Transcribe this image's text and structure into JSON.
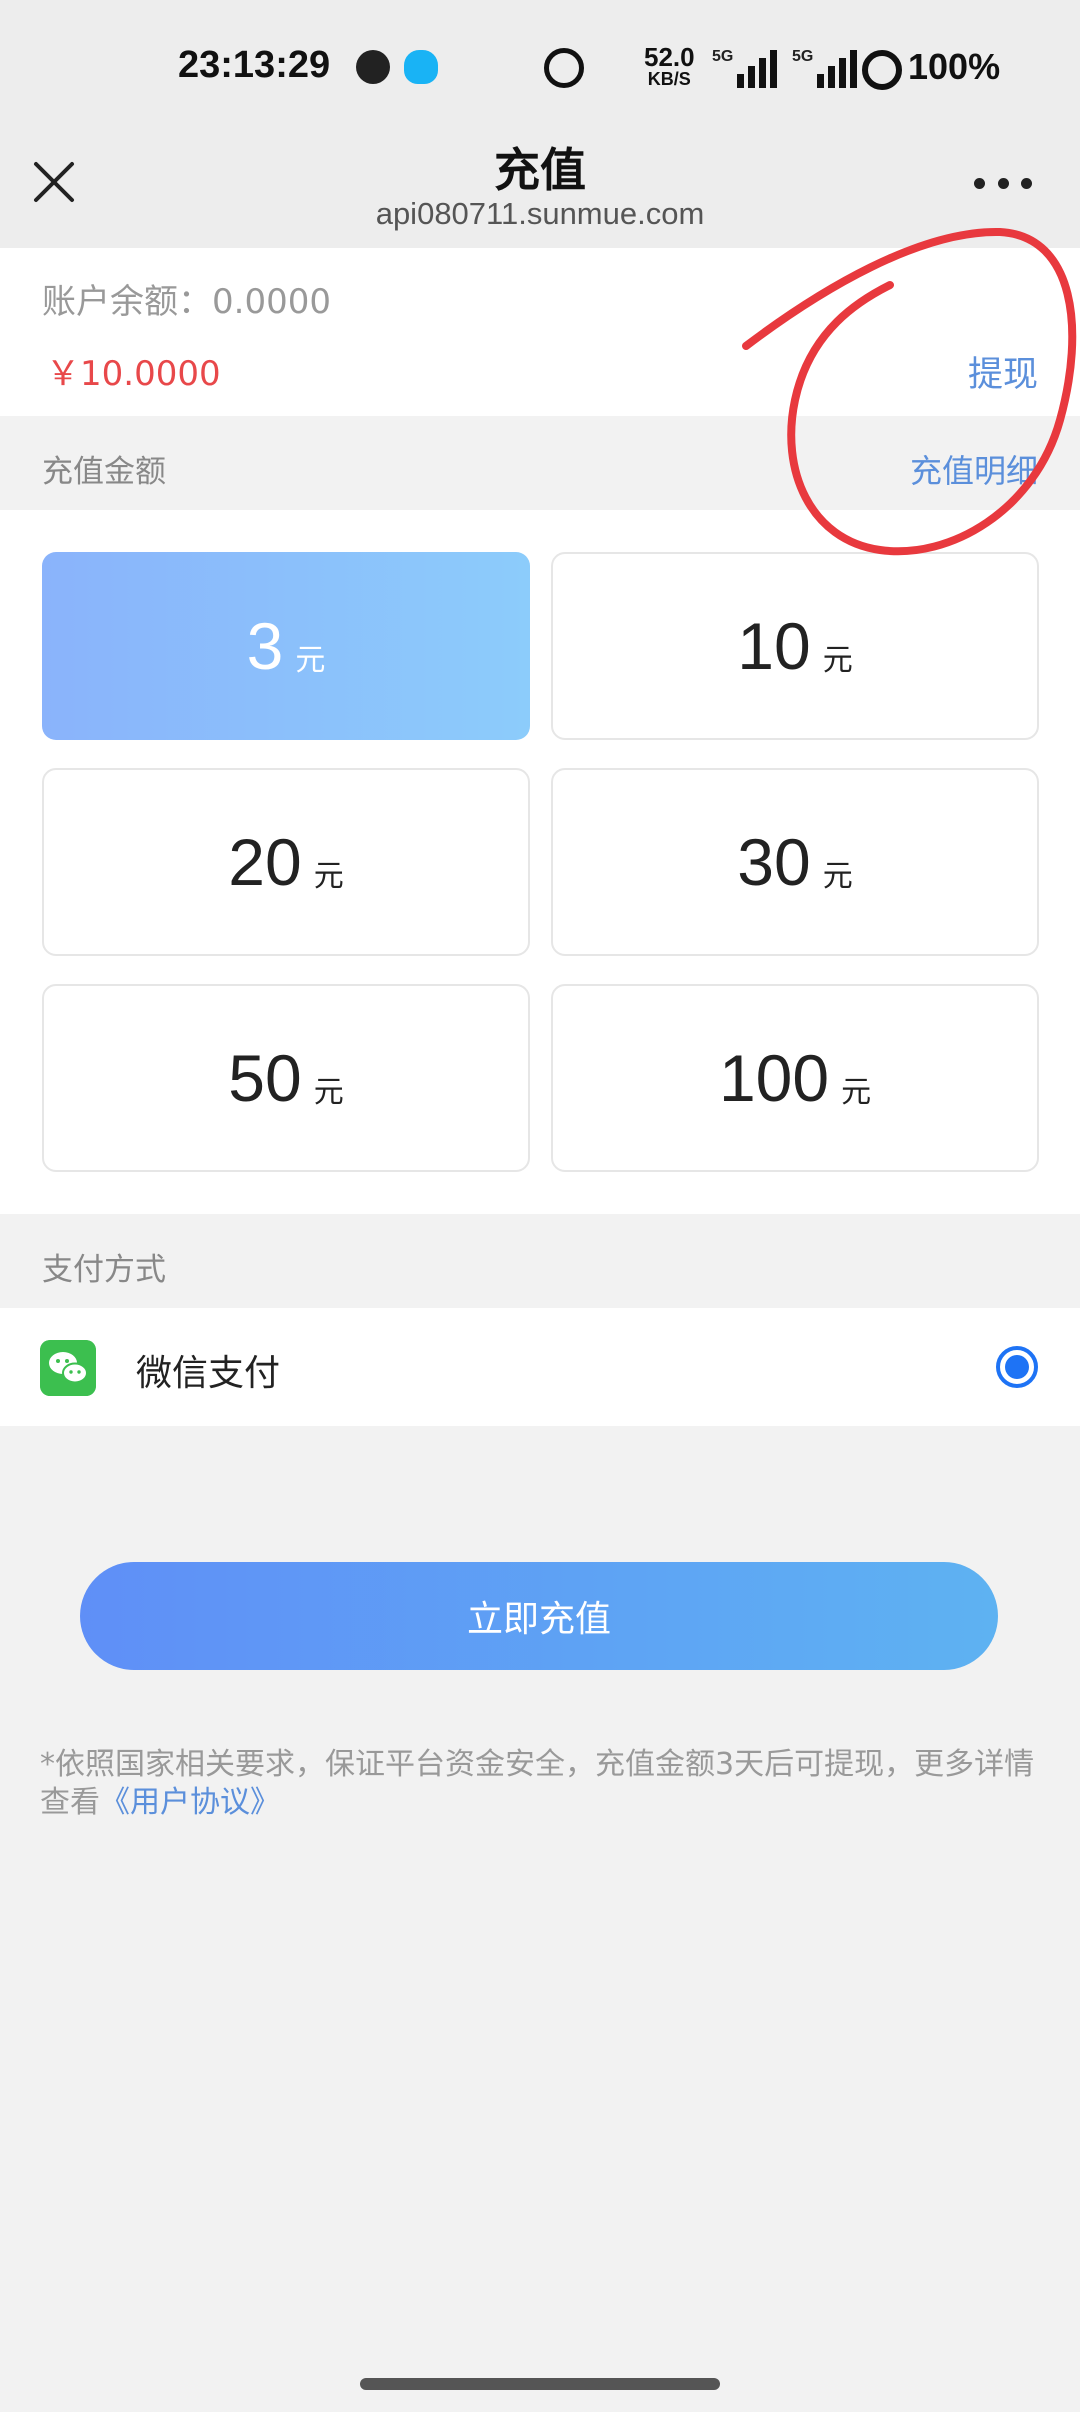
{
  "status_bar": {
    "time": "23:13:29",
    "net_speed_value": "52.0",
    "net_speed_unit": "KB/S",
    "signal_1_tag": "5G",
    "signal_2_tag": "5G",
    "battery": "100%"
  },
  "nav": {
    "title": "充值",
    "subtitle": "api080711.sunmue.com"
  },
  "balance": {
    "label": "账户余额：0.0000",
    "amount": "￥10.0000",
    "withdraw_label": "提现"
  },
  "amount_section": {
    "label": "充值金额",
    "detail_link": "充值明细"
  },
  "amount_options": [
    {
      "value": "3",
      "unit": "元",
      "selected": true
    },
    {
      "value": "10",
      "unit": "元",
      "selected": false
    },
    {
      "value": "20",
      "unit": "元",
      "selected": false
    },
    {
      "value": "30",
      "unit": "元",
      "selected": false
    },
    {
      "value": "50",
      "unit": "元",
      "selected": false
    },
    {
      "value": "100",
      "unit": "元",
      "selected": false
    }
  ],
  "payment_section": {
    "label": "支付方式",
    "method_label": "微信支付",
    "method_icon": "wechat-pay-icon",
    "selected": true
  },
  "submit": {
    "label": "立即充值"
  },
  "notice": {
    "text": "*依照国家相关要求，保证平台资金安全，充值金额3天后可提现，更多详情查看",
    "agreement_link": "《用户协议》"
  },
  "colors": {
    "accent_blue": "#5b8fdb",
    "amount_red": "#e8484a",
    "selected_gradient_start": "#8ab3fb",
    "button_gradient_start": "#5f8ff7",
    "radio_blue": "#1e73f5",
    "annotation_red": "#e8393e"
  }
}
